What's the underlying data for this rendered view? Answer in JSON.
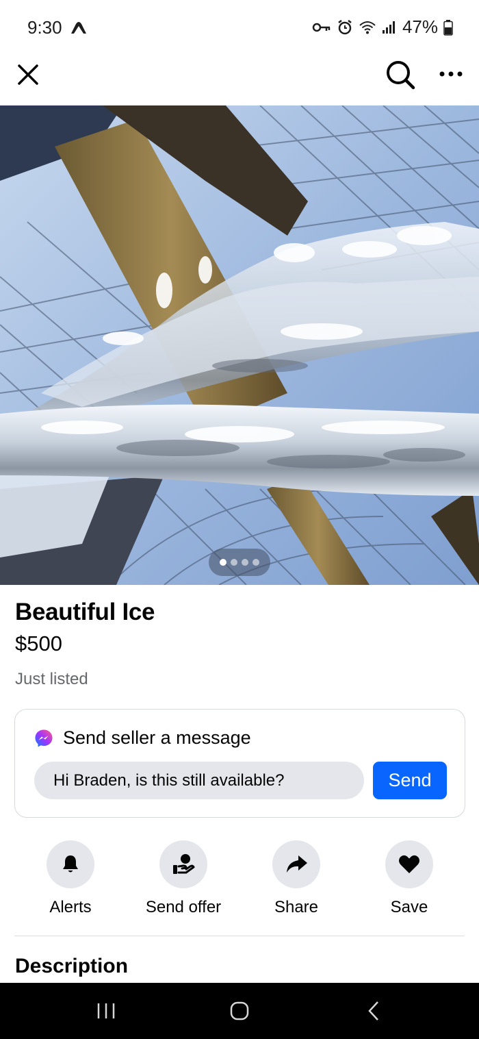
{
  "status_bar": {
    "time": "9:30",
    "battery": "47%"
  },
  "top_nav": {
    "close_icon": "close-icon",
    "search_icon": "search-icon",
    "more_icon": "more-icon"
  },
  "gallery": {
    "photo_count": 4,
    "active_index": 0
  },
  "listing": {
    "title": "Beautiful Ice",
    "price": "$500",
    "status": "Just listed"
  },
  "message": {
    "heading": "Send seller a message",
    "input_value": "Hi Braden, is this still available?",
    "send_label": "Send"
  },
  "actions": [
    {
      "label": "Alerts",
      "icon": "bell-icon"
    },
    {
      "label": "Send offer",
      "icon": "offer-icon"
    },
    {
      "label": "Share",
      "icon": "share-icon"
    },
    {
      "label": "Save",
      "icon": "heart-icon"
    }
  ],
  "description": {
    "heading": "Description"
  },
  "colors": {
    "accent": "#0866ff",
    "secondary_text": "#65676b",
    "chip_bg": "#e4e6eb"
  }
}
